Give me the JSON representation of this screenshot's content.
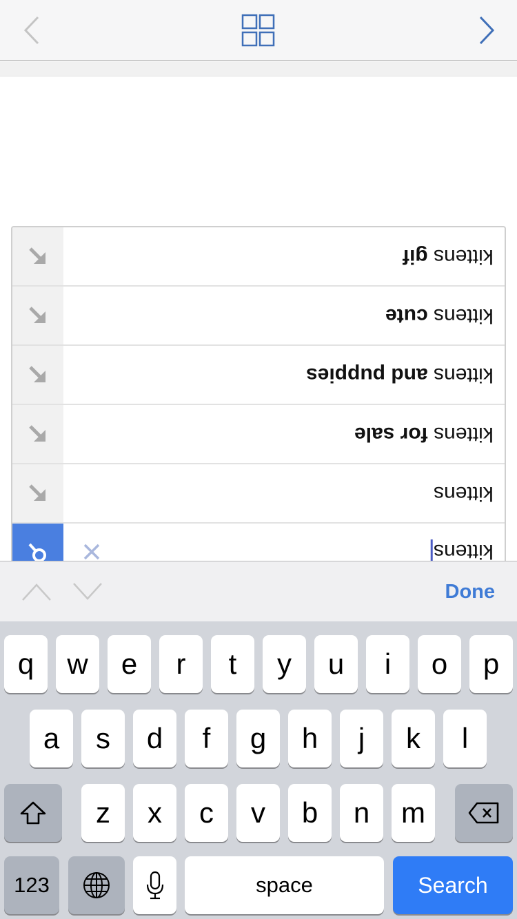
{
  "toolbar": {
    "back_icon": "chevron-left-icon",
    "tabs_icon": "grid-tabs-icon",
    "forward_icon": "chevron-right-icon",
    "colors": {
      "active": "#3f7bd6",
      "disabled": "#c4c4c4"
    }
  },
  "suggestions": {
    "orientation": "rotated-180",
    "items": [
      {
        "prefix": "kittens",
        "completion": "gif",
        "icon": "fill-arrow-icon"
      },
      {
        "prefix": "kittens",
        "completion": "cute",
        "icon": "fill-arrow-icon"
      },
      {
        "prefix": "kittens",
        "completion": "and puppies",
        "icon": "fill-arrow-icon"
      },
      {
        "prefix": "kittens",
        "completion": "for sale",
        "icon": "fill-arrow-icon"
      },
      {
        "prefix": "kittens",
        "completion": "",
        "icon": "fill-arrow-icon"
      }
    ],
    "input": {
      "value": "kittens",
      "icon": "search-icon",
      "clear_icon": "clear-icon",
      "accent": "#4a7fe0"
    }
  },
  "accessory": {
    "prev_icon": "chevron-up-icon",
    "next_icon": "chevron-down-icon",
    "done_label": "Done"
  },
  "keyboard": {
    "row1": [
      "q",
      "w",
      "e",
      "r",
      "t",
      "y",
      "u",
      "i",
      "o",
      "p"
    ],
    "row2": [
      "a",
      "s",
      "d",
      "f",
      "g",
      "h",
      "j",
      "k",
      "l"
    ],
    "row3": [
      "z",
      "x",
      "c",
      "v",
      "b",
      "n",
      "m"
    ],
    "shift_icon": "shift-icon",
    "delete_icon": "backspace-icon",
    "numbers_label": "123",
    "globe_icon": "globe-icon",
    "mic_icon": "microphone-icon",
    "space_label": "space",
    "search_label": "Search",
    "colors": {
      "search_key": "#2f7cf6"
    }
  }
}
